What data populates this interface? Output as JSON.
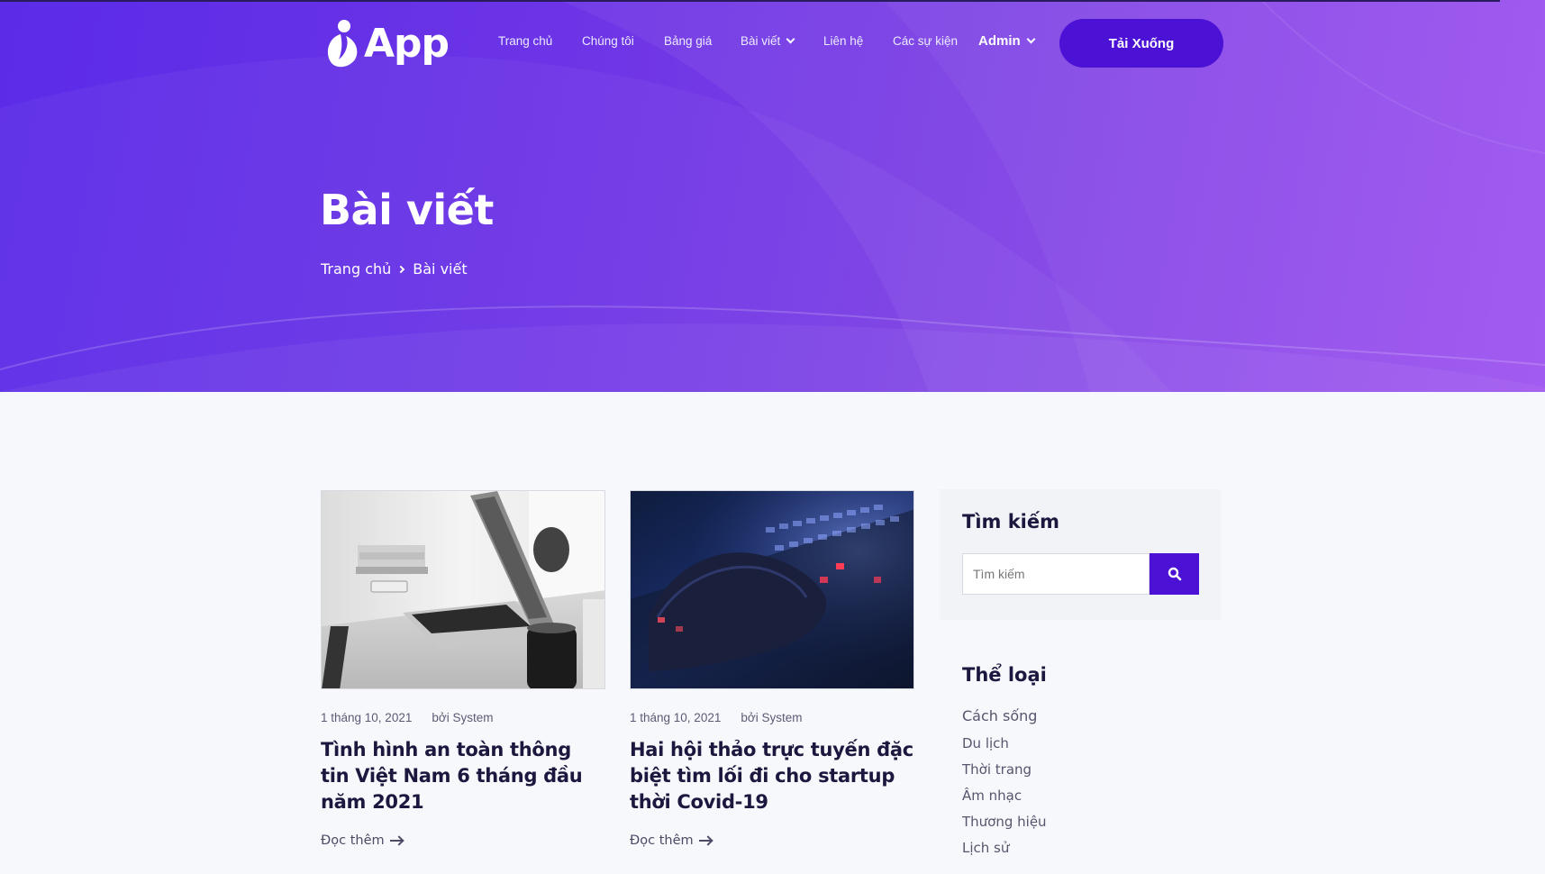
{
  "brand": {
    "logo_text": "App"
  },
  "nav": {
    "items": [
      {
        "label": "Trang chủ"
      },
      {
        "label": "Chúng tôi"
      },
      {
        "label": "Bảng giá"
      },
      {
        "label": "Bài viết",
        "has_dropdown": true
      },
      {
        "label": "Liên hệ"
      },
      {
        "label": "Các sự kiện"
      },
      {
        "label": "Admin",
        "has_dropdown": true
      }
    ],
    "download_label": "Tải Xuống"
  },
  "hero": {
    "title": "Bài viết",
    "breadcrumb": [
      "Trang chủ",
      "Bài viết"
    ]
  },
  "posts": [
    {
      "date": "1 tháng 10, 2021",
      "author": "bởi System",
      "title": "Tình hình an toàn thông tin Việt Nam 6 tháng đầu năm 2021",
      "read_more": "Đọc thêm",
      "image": "laptop-on-desk"
    },
    {
      "date": "1 tháng 10, 2021",
      "author": "bởi System",
      "title": "Hai hội thảo trực tuyến đặc biệt tìm lối đi cho startup thời Covid-19",
      "read_more": "Đọc thêm",
      "image": "hand-on-backlit-keyboard"
    }
  ],
  "sidebar": {
    "search": {
      "title": "Tìm kiếm",
      "placeholder": "Tìm kiếm",
      "icon": "search-icon"
    },
    "categories": {
      "title": "Thể loại",
      "items": [
        "Cách sống",
        "Du lịch",
        "Thời trang",
        "Âm nhạc",
        "Thương hiệu",
        "Lịch sử"
      ]
    }
  },
  "colors": {
    "accent": "#4b12d6",
    "hero_start": "#5b2be8",
    "hero_end": "#9a4cf0"
  }
}
